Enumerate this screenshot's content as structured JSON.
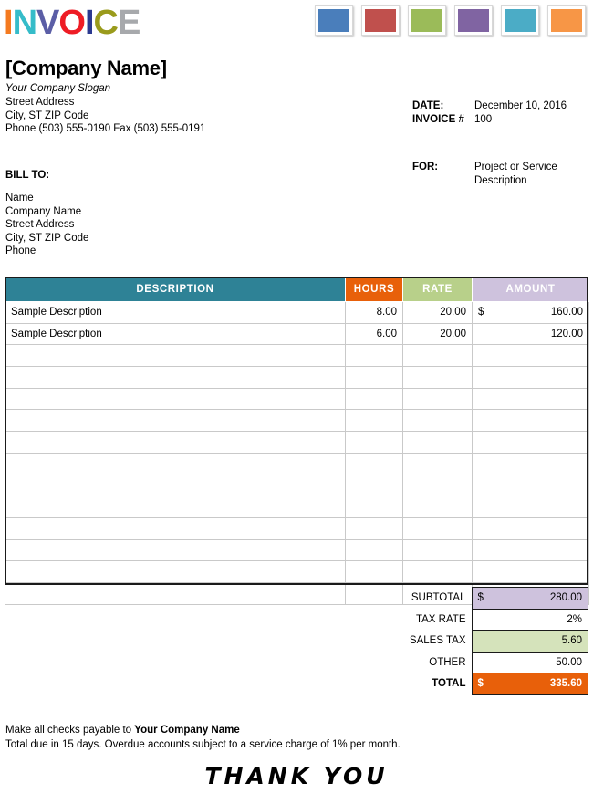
{
  "logo": {
    "letters": [
      {
        "char": "I",
        "color": "#f47a20"
      },
      {
        "char": "N",
        "color": "#35bcc9"
      },
      {
        "char": "V",
        "color": "#5b5ea6"
      },
      {
        "char": "O",
        "color": "#ee1c25"
      },
      {
        "char": "I",
        "color": "#2b3990"
      },
      {
        "char": "C",
        "color": "#9a9b1c"
      },
      {
        "char": "E",
        "color": "#a7a9ac"
      }
    ]
  },
  "swatches": [
    {
      "name": "swatch-blue",
      "color": "#4a7ebb"
    },
    {
      "name": "swatch-red",
      "color": "#c0504d"
    },
    {
      "name": "swatch-green",
      "color": "#9bbb59"
    },
    {
      "name": "swatch-purple",
      "color": "#8064a2"
    },
    {
      "name": "swatch-cyan",
      "color": "#4bacc6"
    },
    {
      "name": "swatch-orange",
      "color": "#f79646"
    }
  ],
  "company": {
    "name": "[Company Name]",
    "slogan": "Your Company Slogan",
    "street": "Street Address",
    "city": "City, ST  ZIP Code",
    "phone_fax": "Phone (503) 555-0190   Fax (503) 555-0191"
  },
  "meta": {
    "date_label": "DATE:",
    "date_value": "December 10, 2016",
    "invoice_label": "INVOICE #",
    "invoice_value": "100"
  },
  "for": {
    "label": "FOR:",
    "line1": "Project or Service",
    "line2": "Description"
  },
  "bill_to": {
    "title": "BILL TO:",
    "lines": [
      "Name",
      "Company Name",
      "Street Address",
      "City, ST  ZIP Code",
      "Phone"
    ]
  },
  "table": {
    "headers": {
      "description": "DESCRIPTION",
      "hours": "HOURS",
      "rate": "RATE",
      "amount": "AMOUNT"
    },
    "rows": [
      {
        "description": "Sample Description",
        "hours": "8.00",
        "rate": "20.00",
        "currency": "$",
        "amount": "160.00"
      },
      {
        "description": "Sample Description",
        "hours": "6.00",
        "rate": "20.00",
        "currency": "",
        "amount": "120.00"
      }
    ],
    "empty_row_count": 12
  },
  "totals": {
    "subtotal_label": "SUBTOTAL",
    "subtotal_currency": "$",
    "subtotal_value": "280.00",
    "tax_rate_label": "TAX RATE",
    "tax_rate_value": "2%",
    "sales_tax_label": "SALES TAX",
    "sales_tax_value": "5.60",
    "other_label": "OTHER",
    "other_value": "50.00",
    "total_label": "TOTAL",
    "total_currency": "$",
    "total_value": "335.60"
  },
  "footer": {
    "payable_prefix": "Make all checks payable to ",
    "payable_company": "Your Company Name",
    "terms": "Total due in 15 days. Overdue accounts subject to a service charge of 1% per month.",
    "thank_you": "THANK YOU"
  }
}
